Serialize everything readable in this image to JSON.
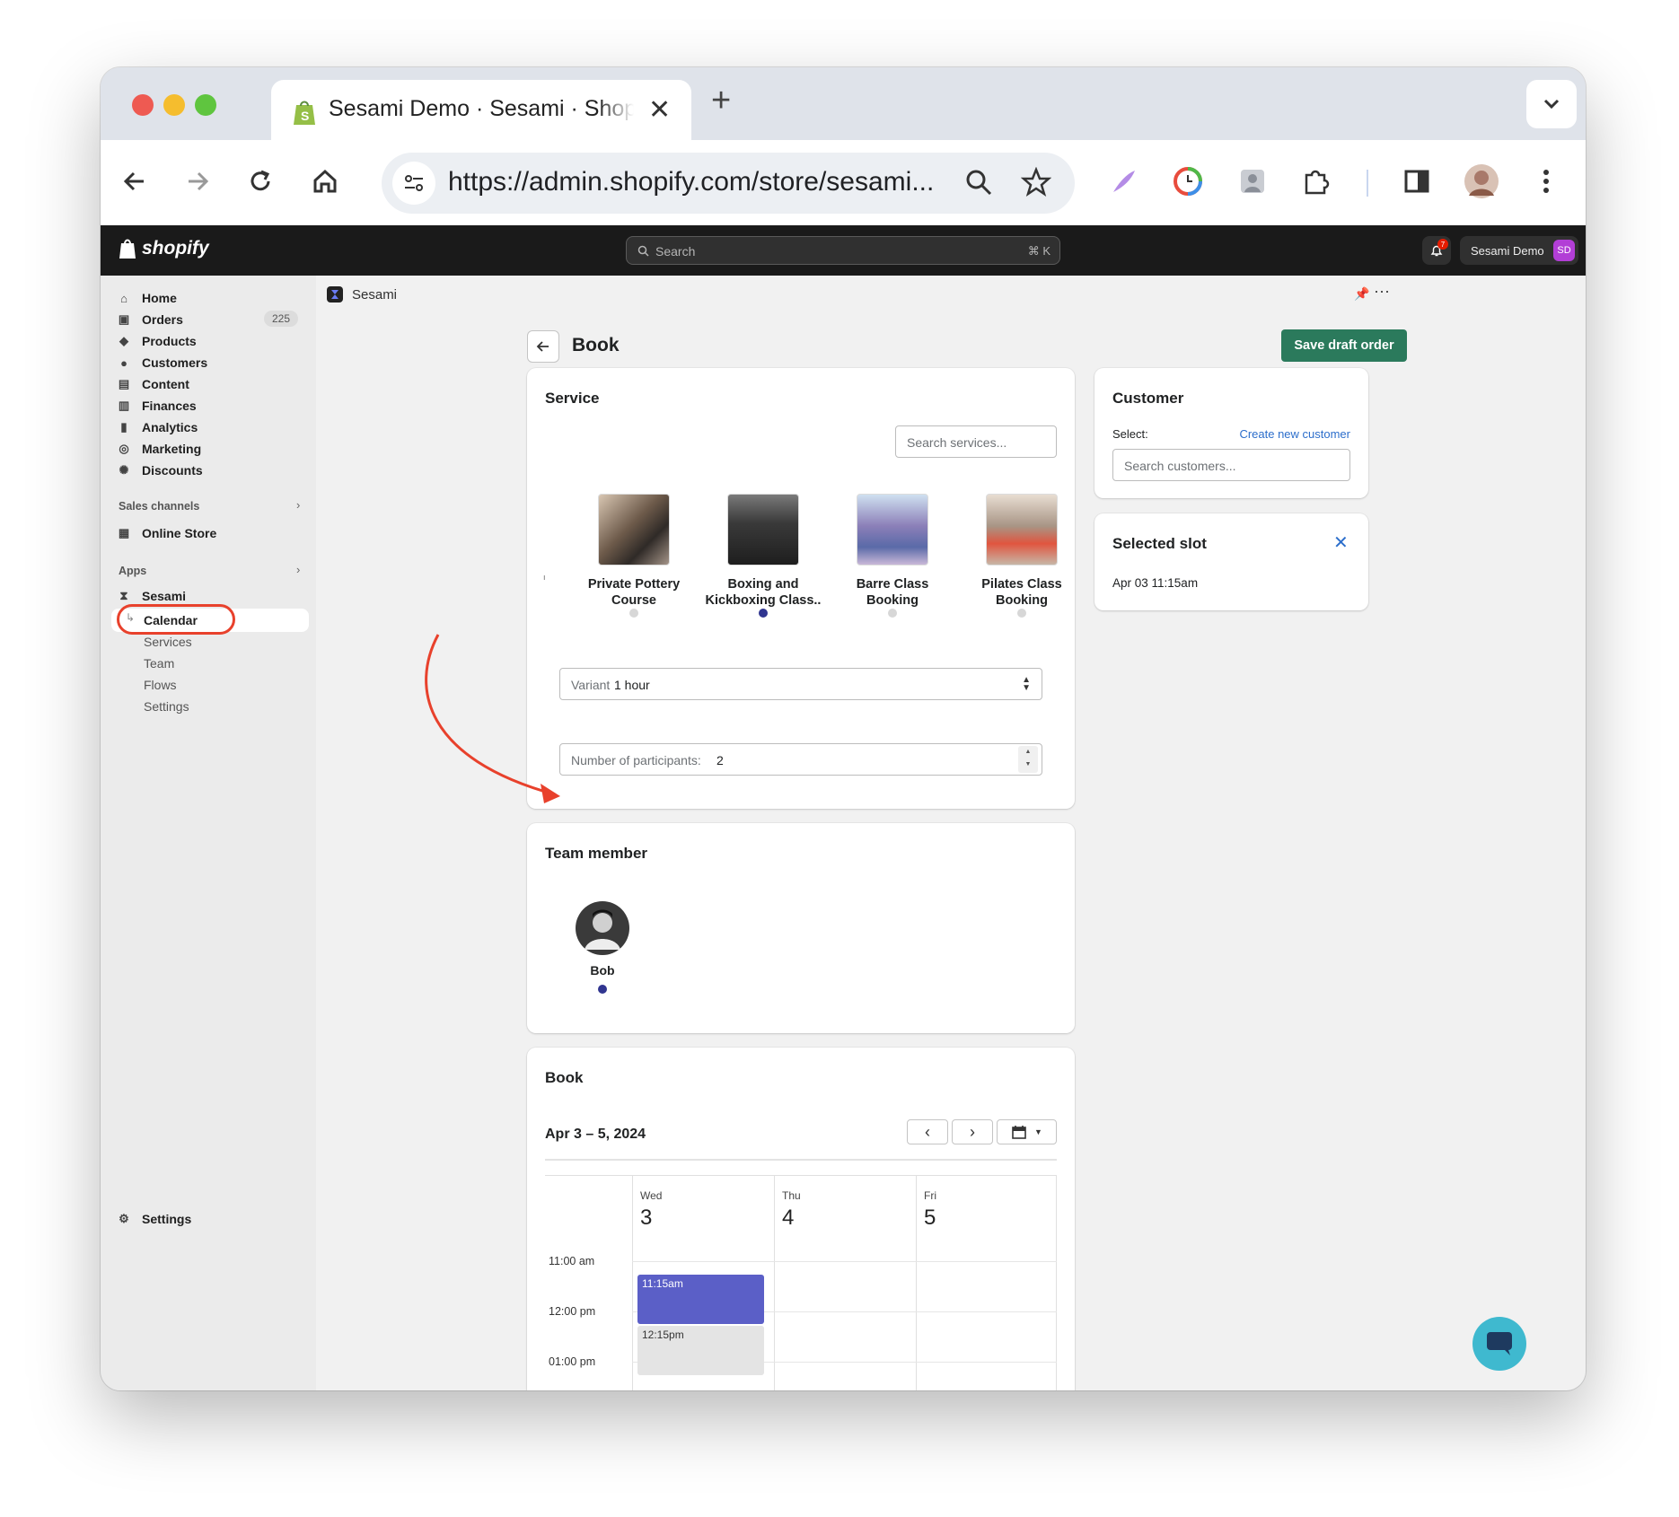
{
  "browser": {
    "tab_title": "Sesami Demo · Sesami · Shopify",
    "new_tab": "+",
    "url": "https://admin.shopify.com/store/sesami..."
  },
  "topbar": {
    "logo": "shopify",
    "search_placeholder": "Search",
    "search_shortcut": "⌘ K",
    "notification_count": "7",
    "account_name": "Sesami Demo",
    "account_initials": "SD"
  },
  "sidebar": {
    "items": [
      {
        "label": "Home",
        "icon": "home-icon"
      },
      {
        "label": "Orders",
        "icon": "orders-icon",
        "badge": "225"
      },
      {
        "label": "Products",
        "icon": "tag-icon"
      },
      {
        "label": "Customers",
        "icon": "person-icon"
      },
      {
        "label": "Content",
        "icon": "content-icon"
      },
      {
        "label": "Finances",
        "icon": "bank-icon"
      },
      {
        "label": "Analytics",
        "icon": "bar-chart-icon"
      },
      {
        "label": "Marketing",
        "icon": "target-icon"
      },
      {
        "label": "Discounts",
        "icon": "discount-icon"
      }
    ],
    "sales_channels_label": "Sales channels",
    "online_store": "Online Store",
    "apps_label": "Apps",
    "app_name": "Sesami",
    "app_subitems": [
      "Calendar",
      "Services",
      "Team",
      "Flows",
      "Settings"
    ],
    "settings": "Settings"
  },
  "appbar": {
    "title": "Sesami"
  },
  "page": {
    "title": "Book",
    "save_button": "Save draft order"
  },
  "service_card": {
    "title": "Service",
    "search_placeholder": "Search services...",
    "services": [
      {
        "name": "Private Pottery Course",
        "line1": "Private Pottery",
        "line2": "Course",
        "selected": false
      },
      {
        "name": "Boxing and Kickboxing Class",
        "line1": "Boxing and",
        "line2": "Kickboxing Class..",
        "selected": true
      },
      {
        "name": "Barre Class Booking",
        "line1": "Barre Class",
        "line2": "Booking",
        "selected": false
      },
      {
        "name": "Pilates Class Booking",
        "line1": "Pilates Class",
        "line2": "Booking",
        "selected": false
      }
    ],
    "variant_label": "Variant",
    "variant_value": "1 hour",
    "participants_label": "Number of participants:",
    "participants_value": "2"
  },
  "team_card": {
    "title": "Team member",
    "member_name": "Bob"
  },
  "book_card": {
    "title": "Book",
    "date_range": "Apr 3 – 5, 2024",
    "days": [
      {
        "dow": "Wed",
        "num": "3"
      },
      {
        "dow": "Thu",
        "num": "4"
      },
      {
        "dow": "Fri",
        "num": "5"
      }
    ],
    "times": [
      "11:00 am",
      "12:00 pm",
      "01:00 pm"
    ],
    "slots": [
      {
        "label": "11:15am",
        "selected": true
      },
      {
        "label": "12:15pm",
        "selected": false
      }
    ]
  },
  "customer_card": {
    "title": "Customer",
    "select_label": "Select:",
    "create_link": "Create new customer",
    "search_placeholder": "Search customers..."
  },
  "selected_slot_card": {
    "title": "Selected slot",
    "value": "Apr 03 11:15am"
  },
  "colors": {
    "accent": "#303590",
    "save_button": "#2b7a5c",
    "annotation": "#e8412c",
    "slot_selected": "#5b5fc7",
    "chat_bubble": "#3fb9cf"
  }
}
